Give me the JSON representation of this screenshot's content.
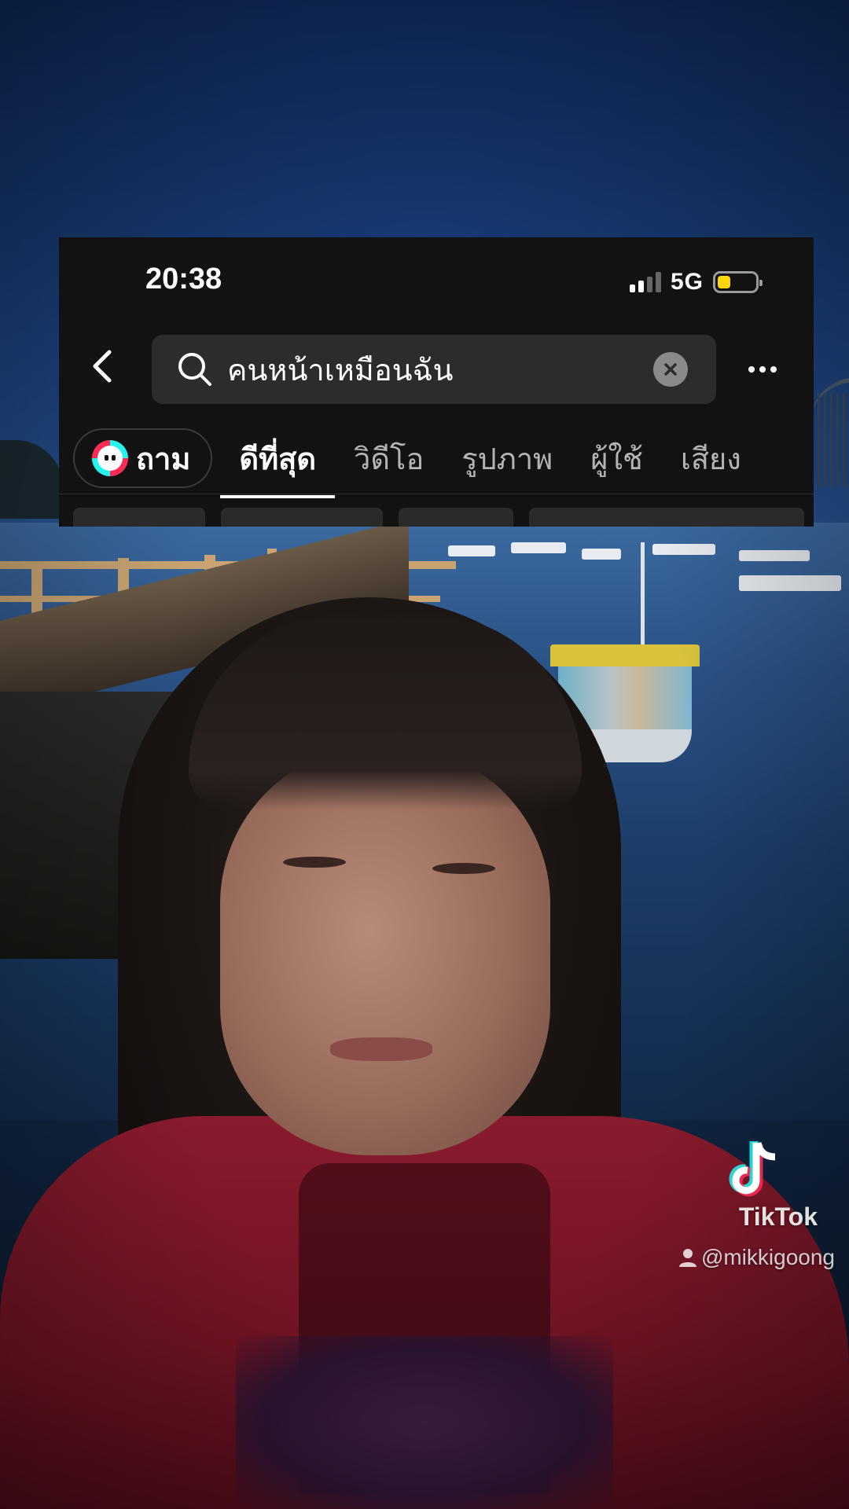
{
  "status_bar": {
    "time": "20:38",
    "network": "5G",
    "battery_level": 0.35,
    "battery_color": "#ffd60a"
  },
  "search": {
    "back_icon": "chevron-left-icon",
    "search_icon": "search-icon",
    "query": "คนหน้าเหมือนฉัน",
    "clear_icon": "close-circle-icon",
    "more_icon": "more-horizontal-icon"
  },
  "tabs": {
    "ask_label": "ถาม",
    "items": [
      {
        "label": "ดีที่สุด",
        "active": true
      },
      {
        "label": "วิดีโอ",
        "active": false
      },
      {
        "label": "รูปภาพ",
        "active": false
      },
      {
        "label": "ผู้ใช้",
        "active": false
      },
      {
        "label": "เสียง",
        "active": false
      }
    ]
  },
  "watermark": {
    "brand": "TikTok",
    "username": "@mikkigoong",
    "user_icon": "person-icon",
    "logo_icon": "tiktok-note-icon"
  },
  "colors": {
    "overlay_bg": "#121212",
    "tiktok_cyan": "#25f4ee",
    "tiktok_red": "#fe2c55"
  }
}
